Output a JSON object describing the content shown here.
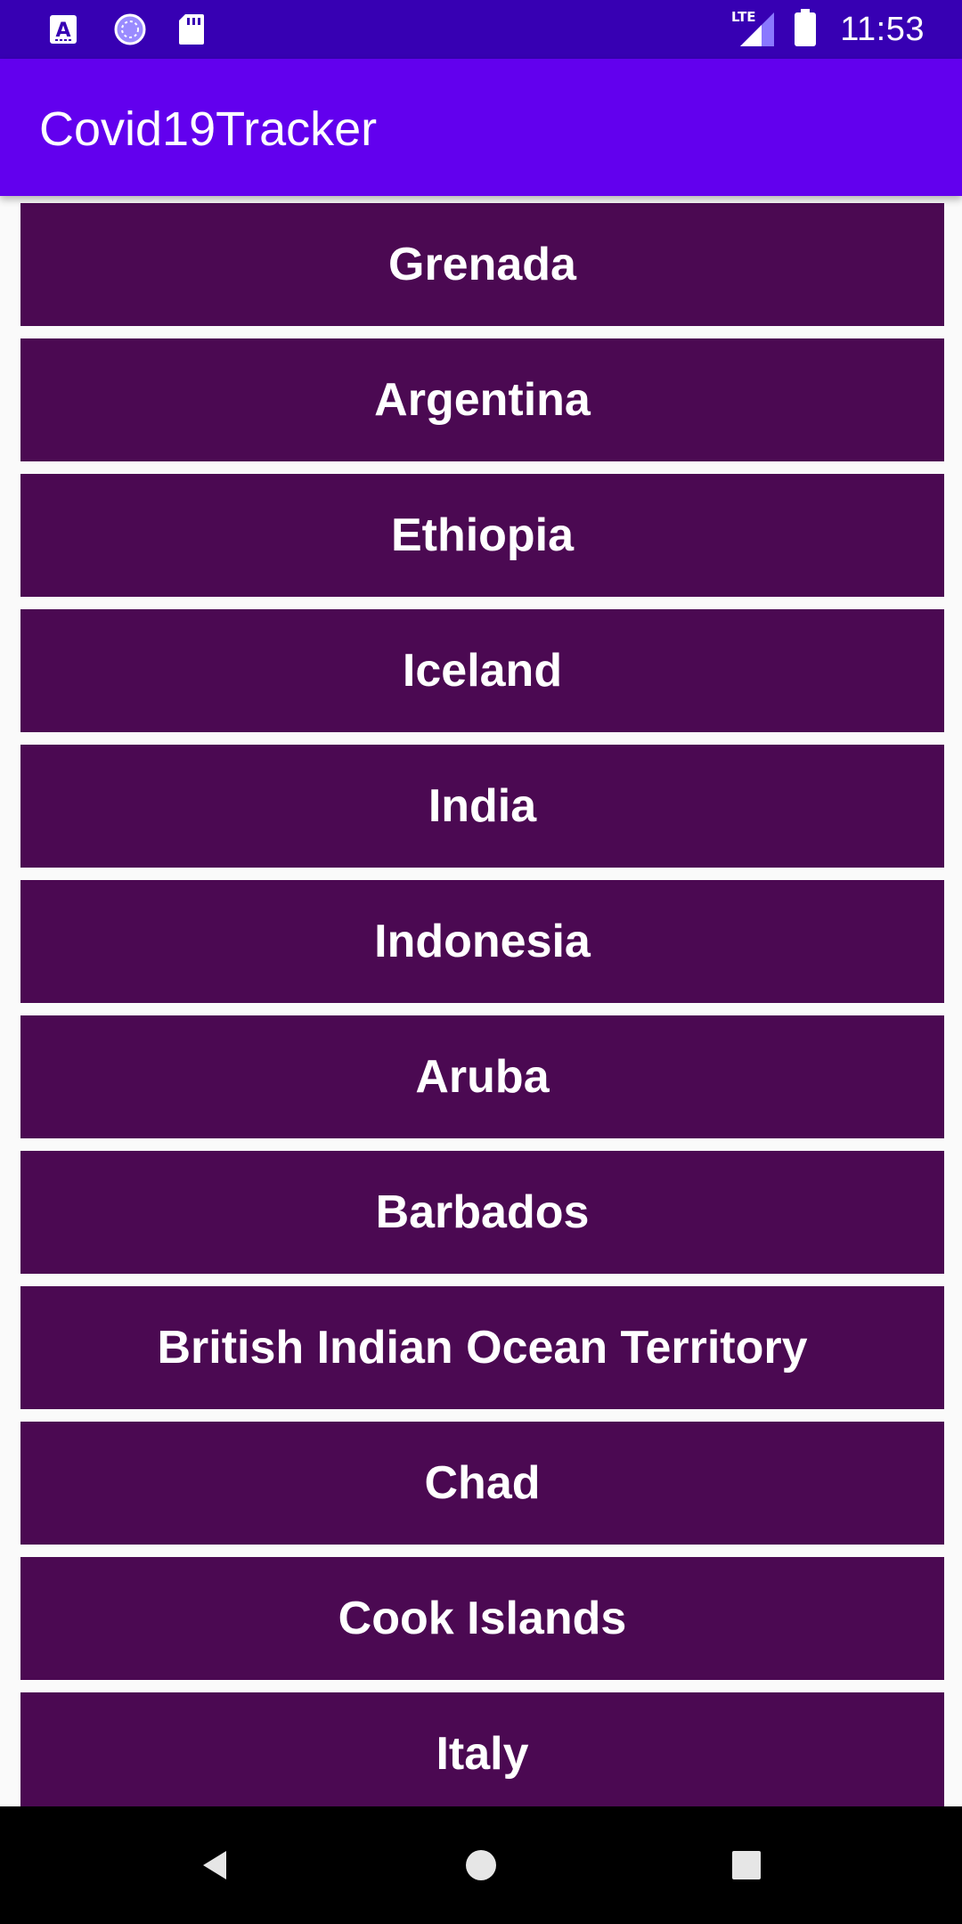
{
  "status_bar": {
    "time": "11:53",
    "network": "LTE",
    "icons": [
      "keyboard-a-icon",
      "sync-circle-icon",
      "sd-card-icon",
      "signal-lte-icon",
      "battery-icon"
    ]
  },
  "app_bar": {
    "title": "Covid19Tracker"
  },
  "countries": [
    "Grenada",
    "Argentina",
    "Ethiopia",
    "Iceland",
    "India",
    "Indonesia",
    "Aruba",
    "Barbados",
    "British Indian Ocean Territory",
    "Chad",
    "Cook Islands",
    "Italy"
  ],
  "nav_bar": {
    "icons": [
      "back-icon",
      "home-icon",
      "recents-icon"
    ]
  },
  "colors": {
    "status_bar": "#3700b3",
    "app_bar": "#6200ee",
    "list_item": "#4b0952",
    "background": "#fafafa"
  }
}
